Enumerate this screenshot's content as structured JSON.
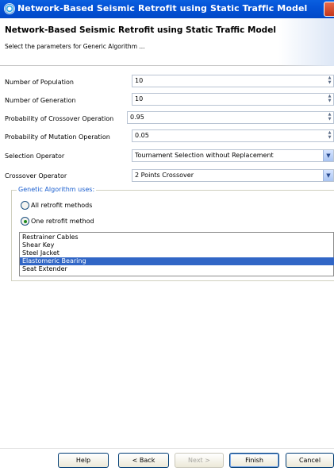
{
  "window": {
    "title": "Network-Based Seismic Retrofit using Static Traffic Model"
  },
  "header": {
    "title": "Network-Based Seismic Retrofit using Static Traffic Model",
    "description": "Select the parameters for Generic Algorithm ..."
  },
  "form": {
    "population": {
      "label": "Number of Population",
      "value": "10"
    },
    "generation": {
      "label": "Number of Generation",
      "value": "10"
    },
    "crossover_prob": {
      "label": "Probability of Crossover Operation",
      "value": "0.95"
    },
    "mutation_prob": {
      "label": "Probability of Mutation Operation",
      "value": "0.05"
    },
    "selection": {
      "label": "Selection Operator",
      "value": "Tournament Selection without Replacement"
    },
    "crossover_op": {
      "label": "Crossover Operator",
      "value": "2 Points Crossover"
    }
  },
  "group": {
    "legend": "Genetic Algorithm uses:",
    "radios": [
      {
        "label": "All retrofit methods",
        "selected": false
      },
      {
        "label": "One retrofit method",
        "selected": true
      }
    ],
    "list": [
      {
        "label": "Restrainer Cables",
        "selected": false
      },
      {
        "label": "Shear Key",
        "selected": false
      },
      {
        "label": "Steel Jacket",
        "selected": false
      },
      {
        "label": "Elastomeric Bearing",
        "selected": true
      },
      {
        "label": "Seat Extender",
        "selected": false
      }
    ]
  },
  "buttons": {
    "help": "Help",
    "back": "< Back",
    "next": "Next >",
    "finish": "Finish",
    "cancel": "Cancel"
  },
  "icons": [
    "app-icon",
    "close-icon",
    "spinner-icon",
    "dropdown-arrow-icon"
  ],
  "colors": {
    "titlebar": "#0553d6",
    "legend": "#1b5fcf",
    "selection": "#3166c6"
  }
}
